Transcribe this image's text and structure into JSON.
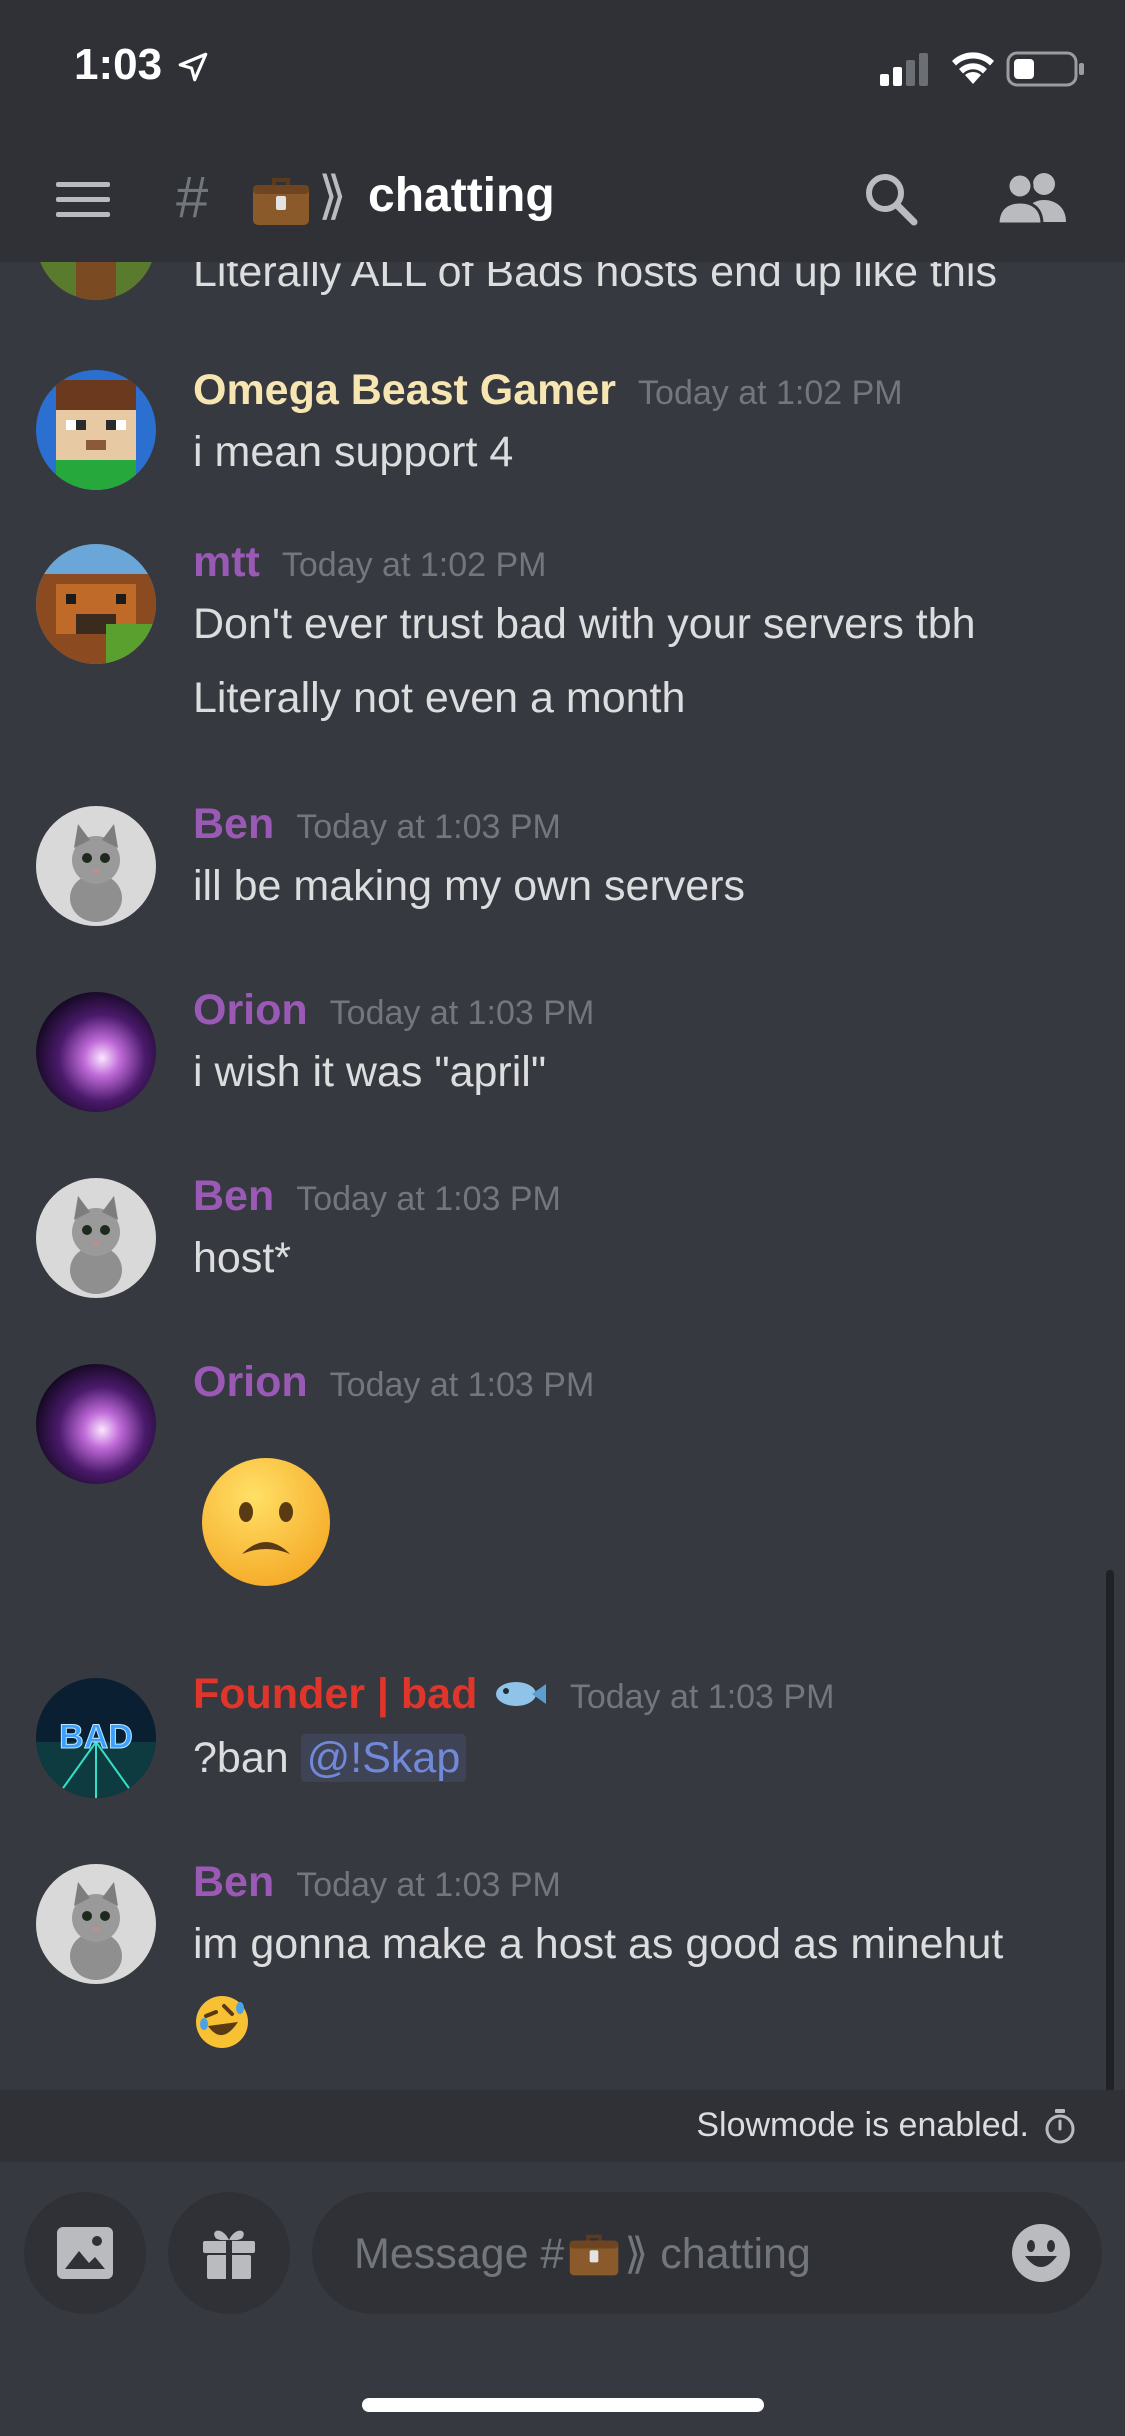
{
  "status_bar": {
    "time": "1:03"
  },
  "header": {
    "channel_prefix": "#",
    "channel_chevrons": "⟫",
    "channel_name": "chatting"
  },
  "partial_message": {
    "text": "Literally ALL of Bads hosts end up like this"
  },
  "messages": [
    {
      "author": "Omega Beast Gamer",
      "author_color": "#f8e6b2",
      "timestamp": "Today at 1:02 PM",
      "lines": [
        "i mean support 4"
      ]
    },
    {
      "author": "mtt",
      "author_color": "#9b59b6",
      "timestamp": "Today at 1:02 PM",
      "lines": [
        "Don't ever trust bad with your servers tbh",
        "Literally not even a month"
      ]
    },
    {
      "author": "Ben",
      "author_color": "#9b59b6",
      "timestamp": "Today at 1:03 PM",
      "lines": [
        "ill be making my own servers"
      ]
    },
    {
      "author": "Orion",
      "author_color": "#9b59b6",
      "timestamp": "Today at 1:03 PM",
      "lines": [
        "i wish it was \"april\""
      ]
    },
    {
      "author": "Ben",
      "author_color": "#9b59b6",
      "timestamp": "Today at 1:03 PM",
      "lines": [
        "host*"
      ]
    },
    {
      "author": "Orion",
      "author_color": "#9b59b6",
      "timestamp": "Today at 1:03 PM",
      "emoji": "frowning-face-emoji"
    },
    {
      "author": "Founder | bad",
      "author_color": "#e0352b",
      "timestamp": "Today at 1:03 PM",
      "command": "?ban",
      "mention": "@!Skap"
    },
    {
      "author": "Ben",
      "author_color": "#9b59b6",
      "timestamp": "Today at 1:03 PM",
      "lines": [
        "im gonna make a host as good as minehut"
      ],
      "trailing_emoji": "rolling-on-floor-laughing-emoji"
    }
  ],
  "slowmode": {
    "text": "Slowmode is enabled."
  },
  "composer": {
    "placeholder_prefix": "Message #",
    "placeholder_chevrons": "⟫",
    "placeholder_channel": "chatting"
  },
  "colors": {
    "background": "#36393f",
    "chrome": "#2f3136",
    "mention": "#7289da",
    "muted": "#72767d"
  }
}
